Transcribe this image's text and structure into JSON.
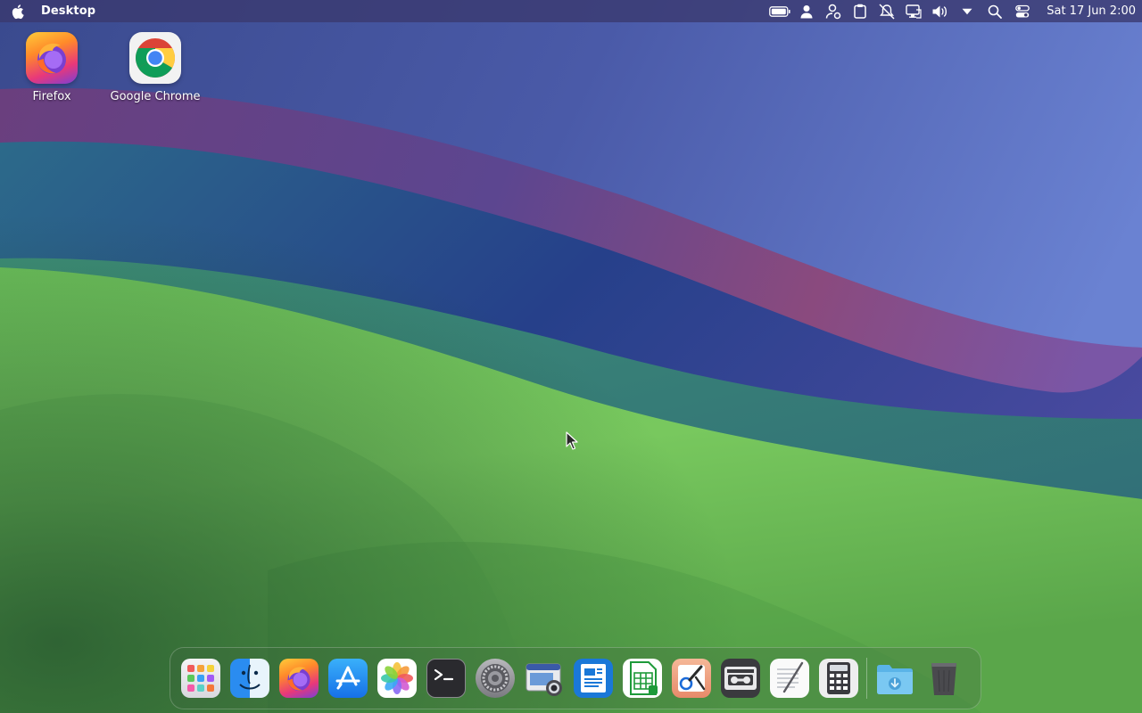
{
  "menubar": {
    "app_name": "Desktop",
    "clock": "Sat 17 Jun  2:00",
    "status_icons": [
      "battery-icon",
      "user-icon",
      "user-account-icon",
      "clipboard-icon",
      "notifications-muted-icon",
      "display-icon",
      "volume-icon",
      "dropdown-arrow-icon",
      "search-icon",
      "control-center-icon"
    ]
  },
  "desktop": {
    "icons": [
      {
        "label": "Firefox",
        "icon": "firefox-icon"
      },
      {
        "label": "Google Chrome",
        "icon": "chrome-icon"
      }
    ]
  },
  "dock": {
    "items": [
      "launchpad-icon",
      "finder-icon",
      "firefox-icon",
      "app-store-icon",
      "photos-icon",
      "terminal-icon",
      "system-settings-icon",
      "screenshot-icon",
      "document-writer-icon",
      "spreadsheet-icon",
      "paint-icon",
      "tape-recorder-icon",
      "text-editor-icon",
      "calculator-icon",
      "downloads-folder-icon",
      "trash-icon"
    ]
  },
  "colors": {
    "menubar_bg": "#3a386e",
    "wallpaper_green": "#76c55c",
    "wallpaper_blue": "#2f4d96",
    "wallpaper_magenta": "#8a4a7e"
  }
}
